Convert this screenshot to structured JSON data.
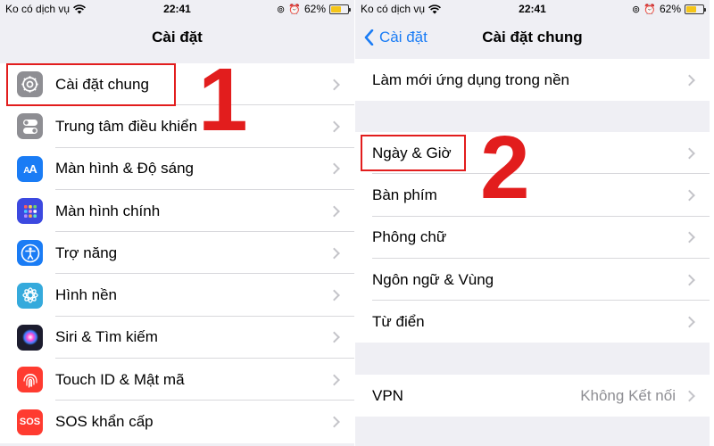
{
  "colors": {
    "accent": "#1a7cf5",
    "annotation": "#e21d1d"
  },
  "left": {
    "status": {
      "carrier": "Ko có dịch vụ",
      "time": "22:41",
      "battery": "62%",
      "battery_level": 0.62
    },
    "nav": {
      "title": "Cài đặt"
    },
    "items": [
      {
        "label": "Cài đặt chung",
        "icon": "gear-icon",
        "color": "#8e8e93"
      },
      {
        "label": "Trung tâm điều khiển",
        "icon": "toggles-icon",
        "color": "#8e8e93"
      },
      {
        "label": "Màn hình & Độ sáng",
        "icon": "text-size-icon",
        "color": "#1a7cf5"
      },
      {
        "label": "Màn hình chính",
        "icon": "home-grid-icon",
        "color": "#3c49e0"
      },
      {
        "label": "Trợ năng",
        "icon": "accessibility-icon",
        "color": "#1a7cf5"
      },
      {
        "label": "Hình nền",
        "icon": "flower-icon",
        "color": "#35aadc"
      },
      {
        "label": "Siri & Tìm kiếm",
        "icon": "siri-icon",
        "color": "#1c1c2e"
      },
      {
        "label": "Touch ID & Mật mã",
        "icon": "fingerprint-icon",
        "color": "#ff3b30"
      },
      {
        "label": "SOS khẩn cấp",
        "icon": "sos-icon",
        "color": "#ff3b30",
        "icon_text": "SOS"
      }
    ],
    "step": "1"
  },
  "right": {
    "status": {
      "carrier": "Ko có dịch vụ",
      "time": "22:41",
      "battery": "62%",
      "battery_level": 0.62
    },
    "nav": {
      "back": "Cài đặt",
      "title": "Cài đặt chung"
    },
    "group1": [
      {
        "label": "Làm mới ứng dụng trong nền"
      }
    ],
    "group2": [
      {
        "label": "Ngày & Giờ"
      },
      {
        "label": "Bàn phím"
      },
      {
        "label": "Phông chữ"
      },
      {
        "label": "Ngôn ngữ & Vùng"
      },
      {
        "label": "Từ điển"
      }
    ],
    "group3": [
      {
        "label": "VPN",
        "value": "Không Kết nối"
      }
    ],
    "step": "2"
  }
}
